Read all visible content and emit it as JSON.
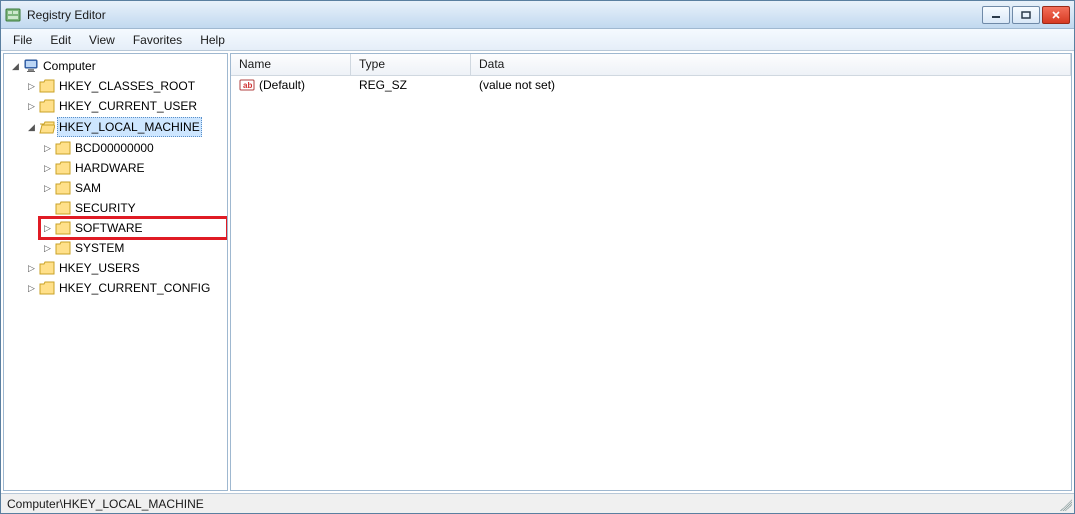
{
  "window": {
    "title": "Registry Editor"
  },
  "menus": {
    "file": "File",
    "edit": "Edit",
    "view": "View",
    "favorites": "Favorites",
    "help": "Help"
  },
  "tree": {
    "root": "Computer",
    "hives": {
      "hkcr": "HKEY_CLASSES_ROOT",
      "hkcu": "HKEY_CURRENT_USER",
      "hklm": "HKEY_LOCAL_MACHINE",
      "hku": "HKEY_USERS",
      "hkcc": "HKEY_CURRENT_CONFIG"
    },
    "hklm_children": {
      "bcd": "BCD00000000",
      "hardware": "HARDWARE",
      "sam": "SAM",
      "security": "SECURITY",
      "software": "SOFTWARE",
      "system": "SYSTEM"
    }
  },
  "list": {
    "headers": {
      "name": "Name",
      "type": "Type",
      "data": "Data"
    },
    "rows": [
      {
        "name": "(Default)",
        "type": "REG_SZ",
        "data": "(value not set)"
      }
    ]
  },
  "statusbar": {
    "path": "Computer\\HKEY_LOCAL_MACHINE"
  },
  "highlight": "software"
}
